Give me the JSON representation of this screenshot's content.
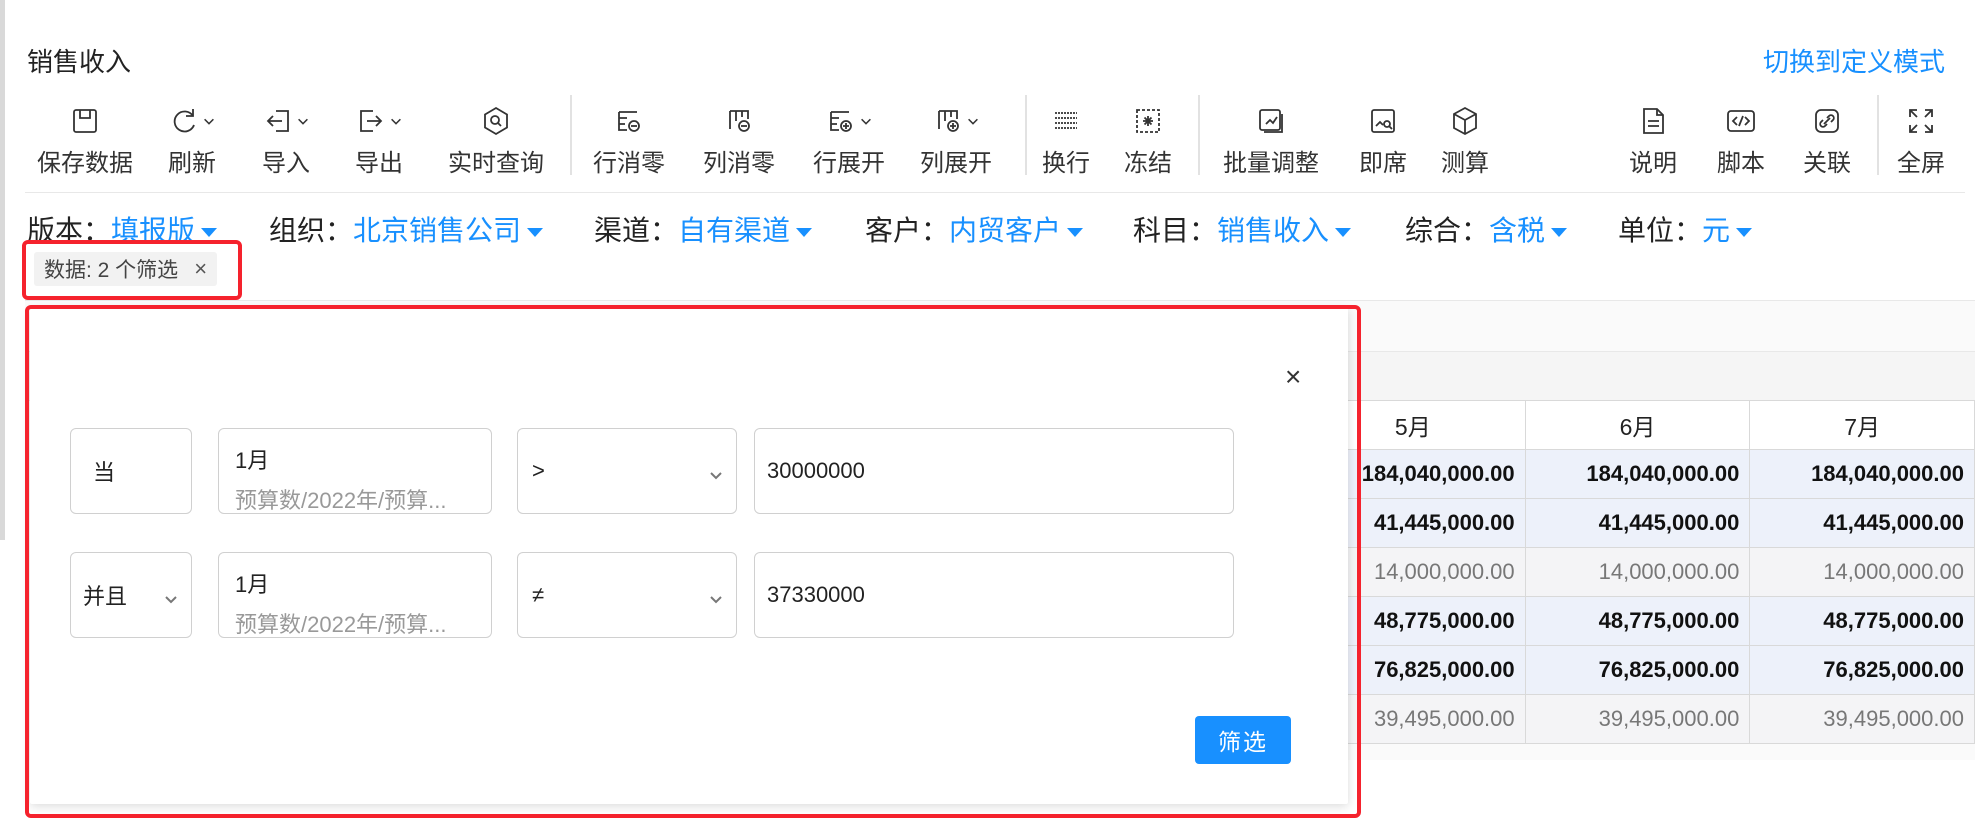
{
  "page": {
    "title": "销售收入",
    "mode_link": "切换到定义模式"
  },
  "toolbar": [
    {
      "label": "保存数据",
      "icon": "save-icon"
    },
    {
      "label": "刷新",
      "icon": "refresh-icon"
    },
    {
      "label": "导入",
      "icon": "import-icon"
    },
    {
      "label": "导出",
      "icon": "export-icon"
    },
    {
      "label": "实时查询",
      "icon": "realtime-query-icon"
    },
    {
      "label": "行消零",
      "icon": "row-remove-zero-icon"
    },
    {
      "label": "列消零",
      "icon": "column-remove-zero-icon"
    },
    {
      "label": "行展开",
      "icon": "row-expand-icon"
    },
    {
      "label": "列展开",
      "icon": "column-expand-icon"
    },
    {
      "label": "换行",
      "icon": "wrap-icon"
    },
    {
      "label": "冻结",
      "icon": "freeze-icon"
    },
    {
      "label": "批量调整",
      "icon": "batch-adjust-icon"
    },
    {
      "label": "即席",
      "icon": "adhoc-icon"
    },
    {
      "label": "测算",
      "icon": "calculate-icon"
    },
    {
      "label": "说明",
      "icon": "description-icon"
    },
    {
      "label": "脚本",
      "icon": "script-icon"
    },
    {
      "label": "关联",
      "icon": "link-icon"
    },
    {
      "label": "全屏",
      "icon": "fullscreen-icon"
    }
  ],
  "filters": [
    {
      "key": "版本：",
      "value": "填报版"
    },
    {
      "key": "组织：",
      "value": "北京销售公司"
    },
    {
      "key": "渠道：",
      "value": "自有渠道"
    },
    {
      "key": "客户：",
      "value": "内贸客户"
    },
    {
      "key": "科目：",
      "value": "销售收入"
    },
    {
      "key": "综合：",
      "value": "含税"
    },
    {
      "key": "单位：",
      "value": "元"
    }
  ],
  "chip": {
    "label": "数据: 2 个筛选",
    "close": "×"
  },
  "dialog": {
    "close": "×",
    "rows": [
      {
        "cond": "当",
        "member": "1月",
        "member_path": "预算数/2022年/预算...",
        "op": ">",
        "value": "30000000"
      },
      {
        "cond": "并且",
        "member": "1月",
        "member_path": "预算数/2022年/预算...",
        "op": "≠",
        "value": "37330000"
      }
    ],
    "submit": "筛选"
  },
  "table": {
    "headers": [
      "5月",
      "6月",
      "7月"
    ],
    "rows": [
      {
        "values": [
          "184,040,000.00",
          "184,040,000.00",
          "184,040,000.00"
        ],
        "style": "bold"
      },
      {
        "values": [
          "41,445,000.00",
          "41,445,000.00",
          "41,445,000.00"
        ],
        "style": "bold"
      },
      {
        "values": [
          "14,000,000.00",
          "14,000,000.00",
          "14,000,000.00"
        ],
        "style": "light"
      },
      {
        "values": [
          "48,775,000.00",
          "48,775,000.00",
          "48,775,000.00"
        ],
        "style": "bold"
      },
      {
        "values": [
          "76,825,000.00",
          "76,825,000.00",
          "76,825,000.00"
        ],
        "style": "bold"
      },
      {
        "values": [
          "39,495,000.00",
          "39,495,000.00",
          "39,495,000.00"
        ],
        "style": "light"
      }
    ]
  },
  "colors": {
    "accent": "#1890ff",
    "highlight": "#f5222d"
  }
}
